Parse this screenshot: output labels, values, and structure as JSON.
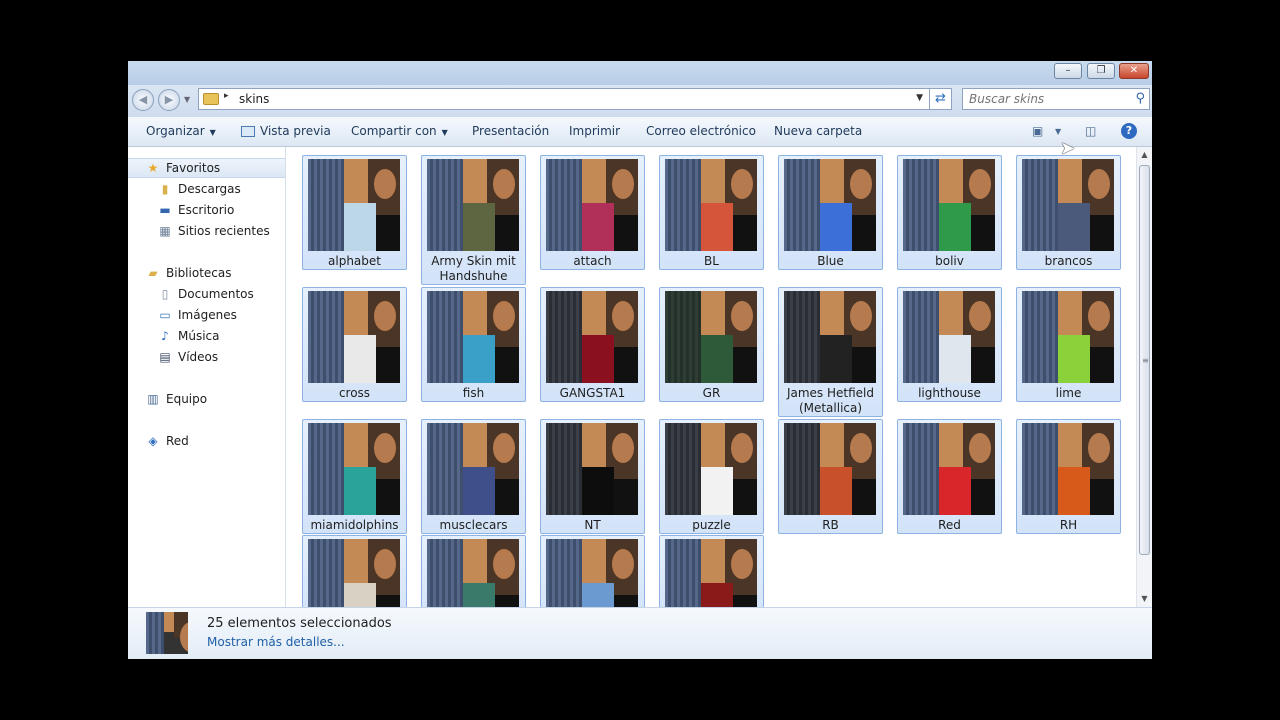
{
  "window": {
    "controls": {
      "minimize": "–",
      "maximize": "❐",
      "close": "✕"
    }
  },
  "address": {
    "back_icon": "back-arrow-icon",
    "forward_icon": "forward-arrow-icon",
    "path": "skins",
    "separator": "▸",
    "search_placeholder": "Buscar skins"
  },
  "toolbar": {
    "organize": "Organizar",
    "preview": "Vista previa",
    "share": "Compartir con",
    "slideshow": "Presentación",
    "print": "Imprimir",
    "email": "Correo electrónico",
    "new_folder": "Nueva carpeta"
  },
  "nav": {
    "favorites": "Favoritos",
    "downloads": "Descargas",
    "desktop": "Escritorio",
    "recent": "Sitios recientes",
    "libraries": "Bibliotecas",
    "documents": "Documentos",
    "pictures": "Imágenes",
    "music": "Música",
    "videos": "Vídeos",
    "computer": "Equipo",
    "network": "Red"
  },
  "files": [
    {
      "name": "alphabet",
      "patch": "#bcd7e8"
    },
    {
      "name": "Army Skin mit Handshuhe",
      "patch": "#5d6640"
    },
    {
      "name": "attach",
      "patch": "#b0305a"
    },
    {
      "name": "BL",
      "patch": "#d4553a"
    },
    {
      "name": "Blue",
      "patch": "#3d6fd8"
    },
    {
      "name": "boliv",
      "patch": "#2f9a4a"
    },
    {
      "name": "brancos",
      "patch": "#4b5a7a"
    },
    {
      "name": "cross",
      "patch": "#e9e9e9"
    },
    {
      "name": "fish",
      "patch": "#3aa0c8"
    },
    {
      "name": "GANGSTA1",
      "patch": "#8a1020"
    },
    {
      "name": "GR",
      "patch": "#2f5a3a"
    },
    {
      "name": "James Hetfield (Metallica)",
      "patch": "#222222"
    },
    {
      "name": "lighthouse",
      "patch": "#dfe6ee"
    },
    {
      "name": "lime",
      "patch": "#8bd13a"
    },
    {
      "name": "miamidolphins",
      "patch": "#2aa39a"
    },
    {
      "name": "musclecars",
      "patch": "#3e4f8a"
    },
    {
      "name": "NT",
      "patch": "#0d0d0d"
    },
    {
      "name": "puzzle",
      "patch": "#f2f2f2"
    },
    {
      "name": "RB",
      "patch": "#c8502a"
    },
    {
      "name": "Red",
      "patch": "#d8262a"
    },
    {
      "name": "RH",
      "patch": "#d85a1a"
    },
    {
      "name": "",
      "patch": "#d9d2c4"
    },
    {
      "name": "",
      "patch": "#3a7a6a"
    },
    {
      "name": "",
      "patch": "#6a9ad0"
    },
    {
      "name": "",
      "patch": "#8a1a1a"
    }
  ],
  "details": {
    "count": "25 elementos seleccionados",
    "more": "Mostrar más detalles..."
  }
}
